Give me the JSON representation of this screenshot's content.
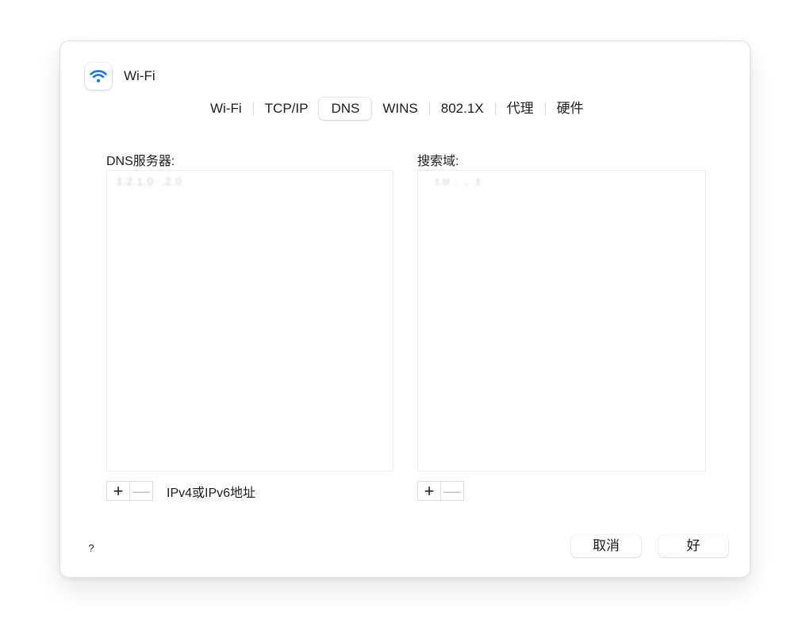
{
  "header": {
    "icon": "wifi-icon",
    "title": "Wi-Fi"
  },
  "tabs": [
    {
      "label": "Wi-Fi"
    },
    {
      "label": "TCP/IP"
    },
    {
      "label": "DNS"
    },
    {
      "label": "WINS"
    },
    {
      "label": "802.1X"
    },
    {
      "label": "代理"
    },
    {
      "label": "硬件"
    }
  ],
  "active_tab": "DNS",
  "dns": {
    "label": "DNS服务器:",
    "servers": [
      "1.2.1.0 ·.2.0"
    ],
    "hint": "IPv4或IPv6地址"
  },
  "search": {
    "label": "搜索域:",
    "domains": [
      "t.tr . ., .t"
    ]
  },
  "controls": {
    "add": "+",
    "remove": "—"
  },
  "footer": {
    "help": "?",
    "cancel": "取消",
    "ok": "好"
  },
  "colors": {
    "accent": "#1a73e8",
    "border": "#e2e2e4"
  }
}
